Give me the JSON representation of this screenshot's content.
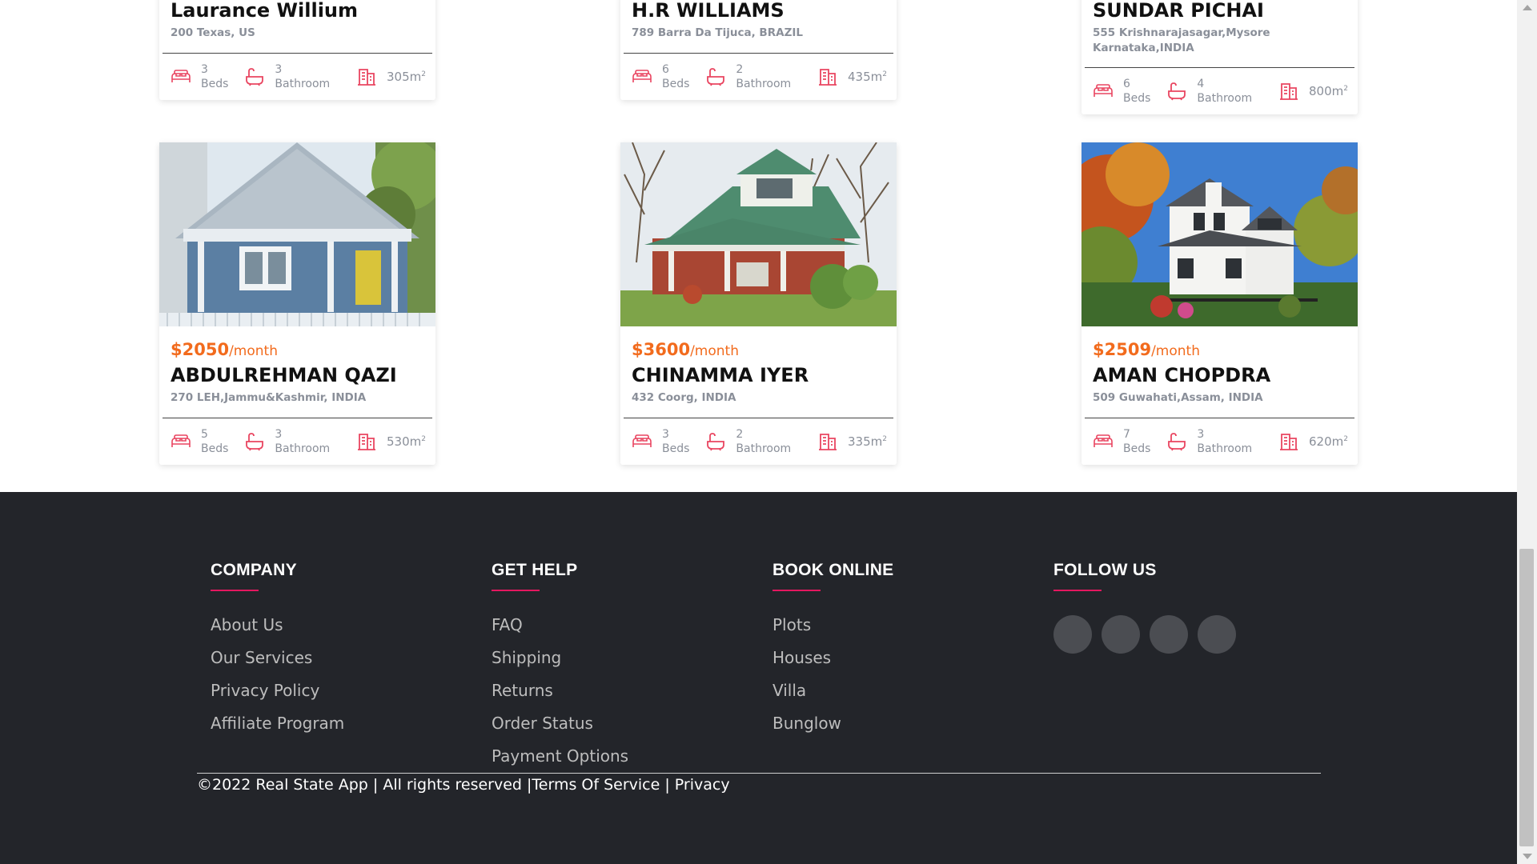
{
  "listings": [
    {
      "price": "",
      "period": "",
      "name": "Laurance Willium",
      "address": "200 Texas, US",
      "beds": "3",
      "baths": "3",
      "area": "305m"
    },
    {
      "price": "",
      "period": "",
      "name": "H.R WILLIAMS",
      "address": "789 Barra Da Tijuca, BRAZIL",
      "beds": "6",
      "baths": "2",
      "area": "435m"
    },
    {
      "price": "",
      "period": "",
      "name": "SUNDAR PICHAI",
      "address": "555 Krishnarajasagar,Mysore Karnataka,INDIA",
      "beds": "6",
      "baths": "4",
      "area": "800m"
    },
    {
      "price": "$2050",
      "period": "/month",
      "name": "ABDULREHMAN QAZI",
      "address": "270 LEH,Jammu&Kashmir, INDIA",
      "beds": "5",
      "baths": "3",
      "area": "530m"
    },
    {
      "price": "$3600",
      "period": "/month",
      "name": "CHINAMMA IYER",
      "address": "432 Coorg, INDIA",
      "beds": "3",
      "baths": "2",
      "area": "335m"
    },
    {
      "price": "$2509",
      "period": "/month",
      "name": "AMAN CHOPDRA",
      "address": "509 Guwahati,Assam, INDIA",
      "beds": "7",
      "baths": "3",
      "area": "620m"
    }
  ],
  "labels": {
    "beds": "Beds",
    "baths": "Bathroom",
    "area_sup": "2"
  },
  "icons": {
    "beds": "bed-icon",
    "baths": "bathtub-icon",
    "area": "building-area-icon"
  },
  "colors": {
    "accent": "#e4175f",
    "price": "#f26b1d",
    "footer_bg": "#23252a",
    "icon": "#e94560"
  },
  "footer": {
    "company": {
      "heading": "COMPANY",
      "links": [
        "About Us",
        "Our Services",
        "Privacy Policy",
        "Affiliate Program"
      ]
    },
    "help": {
      "heading": "GET HELP",
      "links": [
        "FAQ",
        "Shipping",
        "Returns",
        "Order Status",
        "Payment Options"
      ]
    },
    "book": {
      "heading": "BOOK ONLINE",
      "links": [
        "Plots",
        "Houses",
        "Villa",
        "Bunglow"
      ]
    },
    "follow": {
      "heading": "FOLLOW US"
    },
    "copyright": "©2022 Real State App | All rights reserved |Terms Of Service | Privacy"
  }
}
